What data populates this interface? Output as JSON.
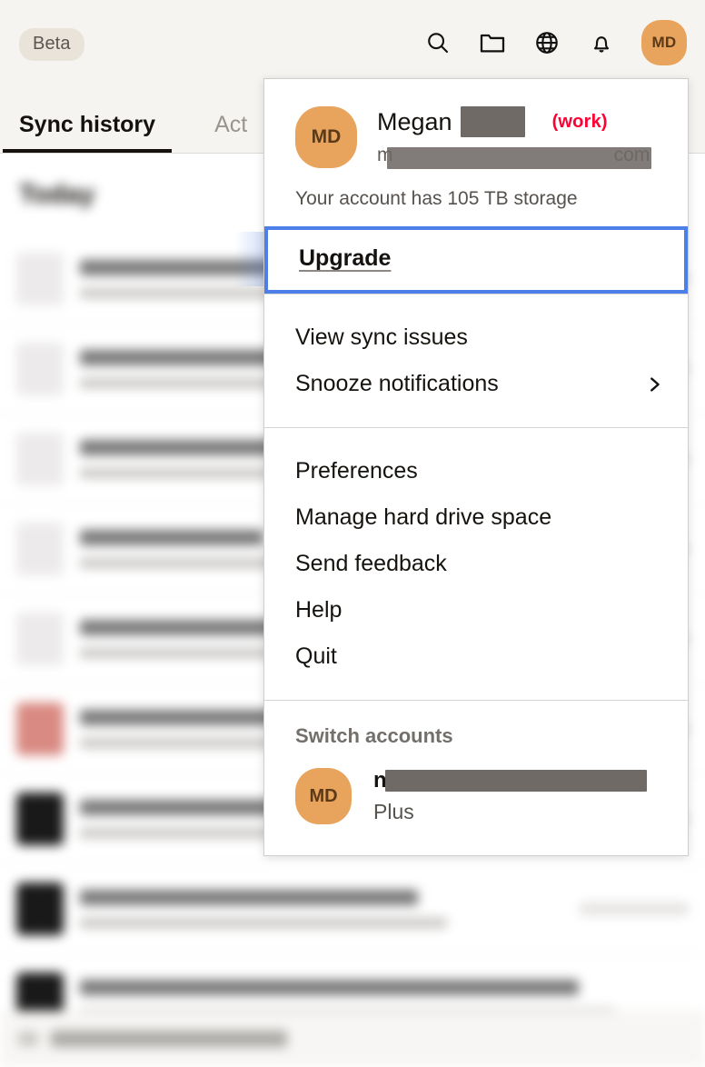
{
  "topbar": {
    "beta_badge": "Beta",
    "icons": [
      {
        "name": "search-icon",
        "label": "Search"
      },
      {
        "name": "folder-icon",
        "label": "Open folder"
      },
      {
        "name": "globe-icon",
        "label": "Open web"
      },
      {
        "name": "bell-icon",
        "label": "Notifications"
      }
    ],
    "avatar_initials": "MD",
    "avatar_color": "#e8a35d"
  },
  "tabs": [
    {
      "label": "Sync history",
      "active": true
    },
    {
      "label": "Act",
      "active": false
    }
  ],
  "content": {
    "section_heading": "Today"
  },
  "menu": {
    "identity": {
      "avatar_initials": "MD",
      "name": "Megan",
      "name_redacted": true,
      "work_tag": "(work)",
      "email_prefix": "m",
      "email_suffix": "com",
      "email_redacted": true
    },
    "storage_line": "Your account has 105 TB storage",
    "upgrade": {
      "label": "Upgrade",
      "focused": true,
      "focus_color": "#4c7fe8"
    },
    "group_one": [
      {
        "label": "View sync issues",
        "has_submenu": false
      },
      {
        "label": "Snooze notifications",
        "has_submenu": true
      }
    ],
    "group_two": [
      {
        "label": "Preferences",
        "has_submenu": false
      },
      {
        "label": "Manage hard drive space",
        "has_submenu": false
      },
      {
        "label": "Send feedback",
        "has_submenu": false
      },
      {
        "label": "Help",
        "has_submenu": false
      },
      {
        "label": "Quit",
        "has_submenu": false
      }
    ],
    "switch_accounts": {
      "title": "Switch accounts",
      "accounts": [
        {
          "avatar_initials": "MD",
          "name_prefix": "n",
          "name_redacted": true,
          "plan": "Plus"
        }
      ]
    }
  }
}
